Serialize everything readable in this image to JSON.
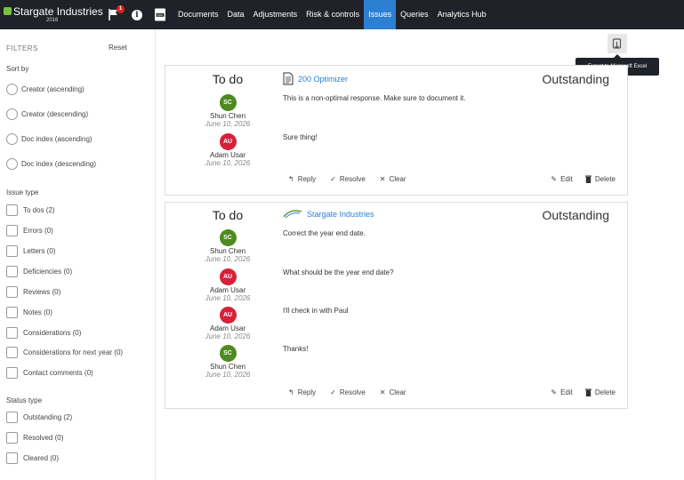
{
  "topbar": {
    "brand_name": "Stargate Industries",
    "brand_year": "2016",
    "flag_badge": "1",
    "nav": [
      "Documents",
      "Data",
      "Adjustments",
      "Risk & controls",
      "Issues",
      "Queries",
      "Analytics Hub"
    ],
    "active_nav": "Issues"
  },
  "sidebar": {
    "title": "FILTERS",
    "reset": "Reset",
    "sort_by": {
      "heading": "Sort by",
      "options": [
        "Creator (ascending)",
        "Creator (descending)",
        "Doc index (ascending)",
        "Doc index (descending)"
      ]
    },
    "issue_type": {
      "heading": "Issue type",
      "options": [
        "To dos (2)",
        "Errors (0)",
        "Letters (0)",
        "Deficiencies (0)",
        "Reviews (0)",
        "Notes (0)",
        "Considerations (0)",
        "Considerations for next year (0)",
        "Contact comments (0)"
      ]
    },
    "status_type": {
      "heading": "Status type",
      "options": [
        "Outstanding (2)",
        "Resolved (0)",
        "Cleared (0)"
      ]
    }
  },
  "export": {
    "icon": "export-excel-icon",
    "tooltip": "Export to Microsoft Excel"
  },
  "issues": [
    {
      "type": "To do",
      "status": "Outstanding",
      "ref_icon": "document-icon",
      "ref": "200 Optimizer",
      "comments": [
        {
          "initials": "SC",
          "name": "Shun Chen",
          "date": "June 10, 2026",
          "color": "#4e8a1f",
          "text": "This is a non-optimal response. Make sure to document it."
        },
        {
          "initials": "AU",
          "name": "Adam Usar",
          "date": "June 10, 2026",
          "color": "#d8203a",
          "text": "Sure thing!"
        }
      ],
      "actions": {
        "reply": "Reply",
        "resolve": "Resolve",
        "clear": "Clear",
        "edit": "Edit",
        "delete": "Delete"
      }
    },
    {
      "type": "To do",
      "status": "Outstanding",
      "ref_icon": "company-logo-icon",
      "ref": "Stargate Industries",
      "comments": [
        {
          "initials": "SC",
          "name": "Shun Chen",
          "date": "June 10, 2026",
          "color": "#4e8a1f",
          "text": "Correct the year end date."
        },
        {
          "initials": "AU",
          "name": "Adam Usar",
          "date": "June 10, 2026",
          "color": "#d8203a",
          "text": "What should be the year end date?"
        },
        {
          "initials": "AU",
          "name": "Adam Usar",
          "date": "June 10, 2026",
          "color": "#d8203a",
          "text": "I'll check in with Paul"
        },
        {
          "initials": "SC",
          "name": "Shun Chen",
          "date": "June 10, 2026",
          "color": "#4e8a1f",
          "text": "Thanks!"
        }
      ],
      "actions": {
        "reply": "Reply",
        "resolve": "Resolve",
        "clear": "Clear",
        "edit": "Edit",
        "delete": "Delete"
      }
    }
  ]
}
